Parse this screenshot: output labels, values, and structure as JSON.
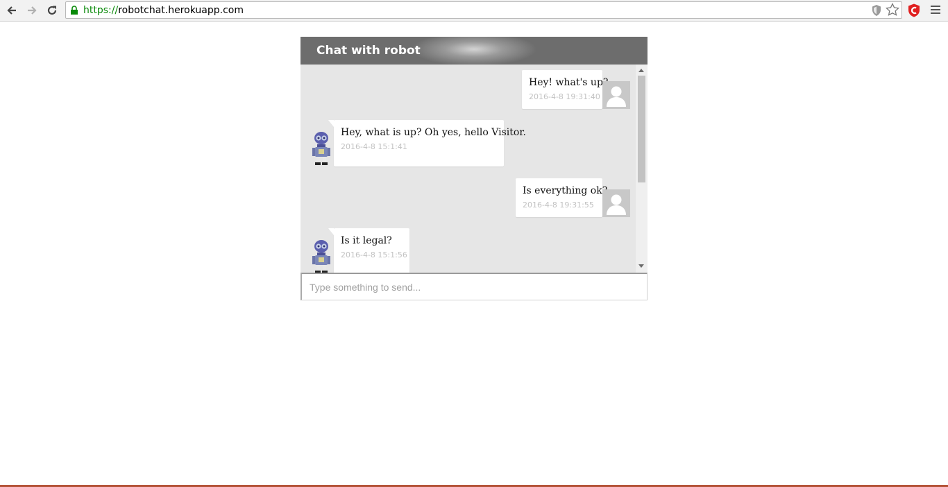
{
  "browser": {
    "url_scheme": "https://",
    "url_rest": "robotchat.herokuapp.com"
  },
  "chat": {
    "title": "Chat with robot",
    "input_placeholder": "Type something to send...",
    "messages": [
      {
        "sender": "user",
        "text": "Hey! what's up?",
        "time": "2016-4-8 19:31:40"
      },
      {
        "sender": "robot",
        "text": "Hey, what is up? Oh yes, hello Visitor.",
        "time": "2016-4-8 15:1:41"
      },
      {
        "sender": "user",
        "text": "Is everything ok?",
        "time": "2016-4-8 19:31:55"
      },
      {
        "sender": "robot",
        "text": "Is it legal?",
        "time": "2016-4-8 15:1:56"
      }
    ]
  },
  "colors": {
    "header": "#6d6d6d",
    "chat_background": "#e6e6e6",
    "url_secure_green": "#0a8a0a",
    "extension_red": "#e02020"
  }
}
